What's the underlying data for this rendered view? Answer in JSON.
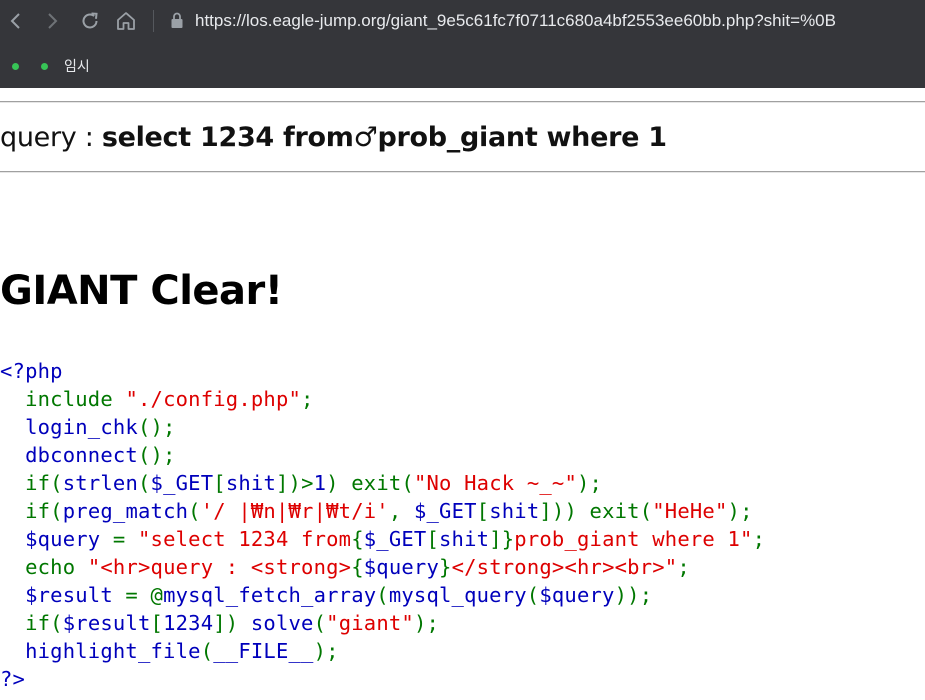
{
  "browser": {
    "url": "https://los.eagle-jump.org/giant_9e5c61fc7f0711c680a4bf2553ee60bb.php?shit=%0B",
    "bookmarks": [
      "",
      "임시"
    ],
    "colors": {
      "toolbar_bg": "#35363a",
      "bookmark_dot": "#37c456"
    }
  },
  "page": {
    "query_prefix": "query : ",
    "query_value": "select 1234 from♂prob_giant where 1",
    "title": "GIANT Clear!",
    "colors": {
      "php_default": "#0000bb",
      "php_keyword": "#007700",
      "php_string": "#dd0000"
    },
    "code_lines": [
      [
        {
          "t": "<?php",
          "c": "default"
        }
      ],
      [
        {
          "t": "  ",
          "c": "default"
        },
        {
          "t": "include ",
          "c": "keyword"
        },
        {
          "t": "\"./config.php\"",
          "c": "string"
        },
        {
          "t": ";",
          "c": "keyword"
        }
      ],
      [
        {
          "t": "  login_chk",
          "c": "default"
        },
        {
          "t": "();",
          "c": "keyword"
        }
      ],
      [
        {
          "t": "  dbconnect",
          "c": "default"
        },
        {
          "t": "();",
          "c": "keyword"
        }
      ],
      [
        {
          "t": "  ",
          "c": "default"
        },
        {
          "t": "if(",
          "c": "keyword"
        },
        {
          "t": "strlen",
          "c": "default"
        },
        {
          "t": "(",
          "c": "keyword"
        },
        {
          "t": "$_GET",
          "c": "default"
        },
        {
          "t": "[",
          "c": "keyword"
        },
        {
          "t": "shit",
          "c": "default"
        },
        {
          "t": "])>",
          "c": "keyword"
        },
        {
          "t": "1",
          "c": "default"
        },
        {
          "t": ") exit(",
          "c": "keyword"
        },
        {
          "t": "\"No Hack ~_~\"",
          "c": "string"
        },
        {
          "t": ");",
          "c": "keyword"
        }
      ],
      [
        {
          "t": "  ",
          "c": "default"
        },
        {
          "t": "if(",
          "c": "keyword"
        },
        {
          "t": "preg_match",
          "c": "default"
        },
        {
          "t": "(",
          "c": "keyword"
        },
        {
          "t": "'/ |₩n|₩r|₩t/i'",
          "c": "string"
        },
        {
          "t": ", ",
          "c": "keyword"
        },
        {
          "t": "$_GET",
          "c": "default"
        },
        {
          "t": "[",
          "c": "keyword"
        },
        {
          "t": "shit",
          "c": "default"
        },
        {
          "t": "])) exit(",
          "c": "keyword"
        },
        {
          "t": "\"HeHe\"",
          "c": "string"
        },
        {
          "t": ");",
          "c": "keyword"
        }
      ],
      [
        {
          "t": "  $query ",
          "c": "default"
        },
        {
          "t": "= ",
          "c": "keyword"
        },
        {
          "t": "\"select 1234 from",
          "c": "string"
        },
        {
          "t": "{",
          "c": "keyword"
        },
        {
          "t": "$_GET",
          "c": "default"
        },
        {
          "t": "[",
          "c": "keyword"
        },
        {
          "t": "shit",
          "c": "default"
        },
        {
          "t": "]}",
          "c": "keyword"
        },
        {
          "t": "prob_giant where 1\"",
          "c": "string"
        },
        {
          "t": ";",
          "c": "keyword"
        }
      ],
      [
        {
          "t": "  ",
          "c": "default"
        },
        {
          "t": "echo ",
          "c": "keyword"
        },
        {
          "t": "\"<hr>query : <strong>",
          "c": "string"
        },
        {
          "t": "{",
          "c": "keyword"
        },
        {
          "t": "$query",
          "c": "default"
        },
        {
          "t": "}",
          "c": "keyword"
        },
        {
          "t": "</strong><hr><br>\"",
          "c": "string"
        },
        {
          "t": ";",
          "c": "keyword"
        }
      ],
      [
        {
          "t": "  $result ",
          "c": "default"
        },
        {
          "t": "= @",
          "c": "keyword"
        },
        {
          "t": "mysql_fetch_array",
          "c": "default"
        },
        {
          "t": "(",
          "c": "keyword"
        },
        {
          "t": "mysql_query",
          "c": "default"
        },
        {
          "t": "(",
          "c": "keyword"
        },
        {
          "t": "$query",
          "c": "default"
        },
        {
          "t": "));",
          "c": "keyword"
        }
      ],
      [
        {
          "t": "  ",
          "c": "default"
        },
        {
          "t": "if(",
          "c": "keyword"
        },
        {
          "t": "$result",
          "c": "default"
        },
        {
          "t": "[",
          "c": "keyword"
        },
        {
          "t": "1234",
          "c": "default"
        },
        {
          "t": "]) ",
          "c": "keyword"
        },
        {
          "t": "solve",
          "c": "default"
        },
        {
          "t": "(",
          "c": "keyword"
        },
        {
          "t": "\"giant\"",
          "c": "string"
        },
        {
          "t": ");",
          "c": "keyword"
        }
      ],
      [
        {
          "t": "  highlight_file",
          "c": "default"
        },
        {
          "t": "(",
          "c": "keyword"
        },
        {
          "t": "__FILE__",
          "c": "default"
        },
        {
          "t": ");",
          "c": "keyword"
        }
      ],
      [
        {
          "t": "?>",
          "c": "default"
        }
      ]
    ]
  },
  "icons": {
    "back": "arrow-left-icon",
    "forward": "arrow-right-icon",
    "reload": "reload-icon",
    "home": "home-icon",
    "lock": "lock-icon"
  }
}
